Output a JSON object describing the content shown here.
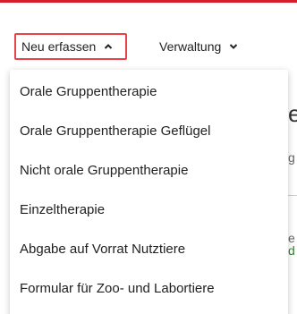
{
  "nav": {
    "new_entry_label": "Neu erfassen",
    "new_entry_chevron": "chevron-up-icon",
    "administration_label": "Verwaltung",
    "administration_chevron": "chevron-down-icon"
  },
  "dropdown": {
    "items": [
      {
        "label": "Orale Gruppentherapie"
      },
      {
        "label": "Orale Gruppentherapie Geflügel"
      },
      {
        "label": "Nicht orale Gruppentherapie"
      },
      {
        "label": "Einzeltherapie"
      },
      {
        "label": "Abgabe auf Vorrat Nutztiere"
      },
      {
        "label": "Formular für Zoo- und Labortiere"
      }
    ]
  },
  "background": {
    "peek_1": "e",
    "peek_2": "g",
    "peek_3": "e",
    "peek_4": "d"
  },
  "colors": {
    "brand_red": "#d81e2c",
    "highlight_border": "#e8424a"
  }
}
